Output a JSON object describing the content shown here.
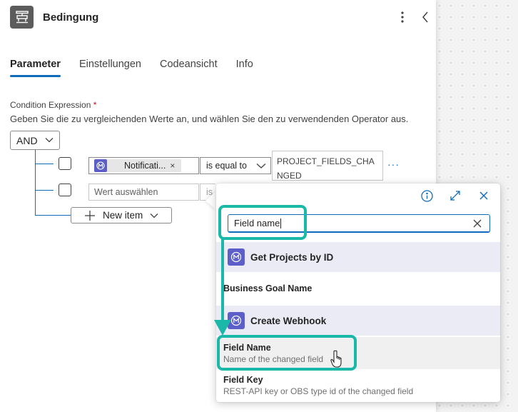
{
  "header": {
    "title": "Bedingung",
    "more_icon": "more-vertical-icon",
    "back_icon": "chevron-left-icon"
  },
  "tabs": [
    {
      "label": "Parameter",
      "active": true
    },
    {
      "label": "Einstellungen",
      "active": false
    },
    {
      "label": "Codeansicht",
      "active": false
    },
    {
      "label": "Info",
      "active": false
    }
  ],
  "condition": {
    "label": "Condition Expression",
    "required_mark": "*",
    "description": "Geben Sie die zu vergleichenden Werte an, und wählen Sie den zu verwendenden Operator aus.",
    "group_operator": "AND",
    "rows": [
      {
        "token_label": "Notificati...",
        "token_remove": "×",
        "operator": "is equal to",
        "value": "PROJECT_FIELDS_CHANGED"
      },
      {
        "placeholder": "Wert auswählen",
        "operator_partial": "is"
      }
    ],
    "row_more": "···",
    "new_item_label": "New item"
  },
  "popup": {
    "search_value": "Field name",
    "groups": [
      {
        "title": "Get Projects by ID",
        "items": [
          {
            "title": "Business Goal Name",
            "subtitle": ""
          }
        ]
      },
      {
        "title": "Create Webhook",
        "items": [
          {
            "title": "Field Name",
            "subtitle": "Name of the changed field"
          },
          {
            "title": "Field Key",
            "subtitle": "REST-API key or OBS type id of the changed field"
          }
        ]
      }
    ]
  },
  "colors": {
    "accent": "#0f6cbd",
    "highlight": "#1ab8a8",
    "connector": "#5b5fc7",
    "group_bg": "#ebebf5"
  }
}
